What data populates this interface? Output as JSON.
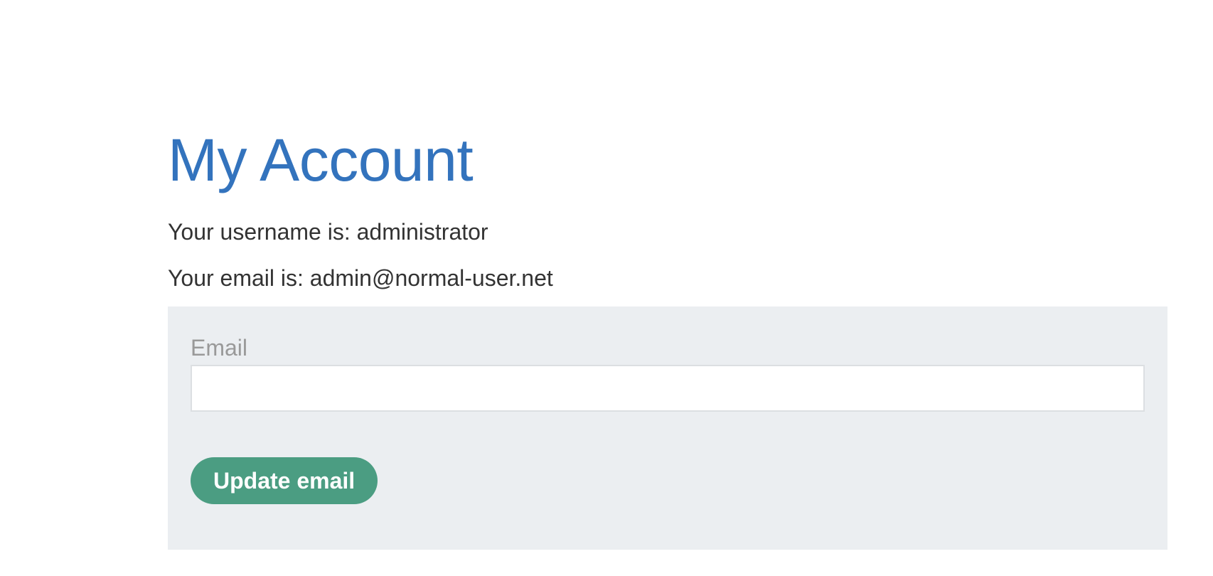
{
  "page": {
    "title": "My Account"
  },
  "account": {
    "username_text": "Your username is: administrator",
    "email_text": "Your email is: admin@normal-user.net"
  },
  "form": {
    "email_label": "Email",
    "email_value": "",
    "submit_label": "Update email"
  },
  "colors": {
    "title": "#3373bd",
    "form_background": "#ebeef1",
    "button": "#4b9d82"
  }
}
